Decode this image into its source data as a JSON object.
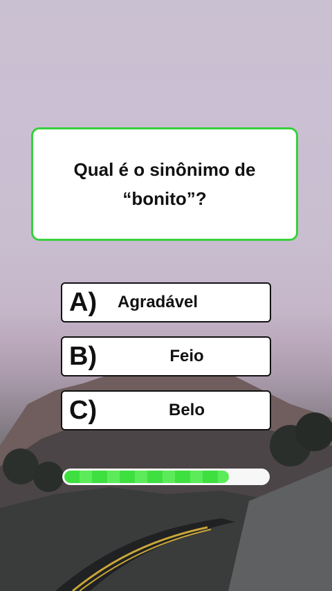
{
  "question": {
    "line1": "Qual é o sinônimo de",
    "line2": "“bonito”?"
  },
  "options": [
    {
      "letter": "A)",
      "text": "Agradável"
    },
    {
      "letter": "B)",
      "text": "Feio"
    },
    {
      "letter": "C)",
      "text": "Belo"
    }
  ],
  "timer": {
    "progress": 0.81
  },
  "colors": {
    "accent": "#36d13c",
    "progress": "#3ee040"
  }
}
